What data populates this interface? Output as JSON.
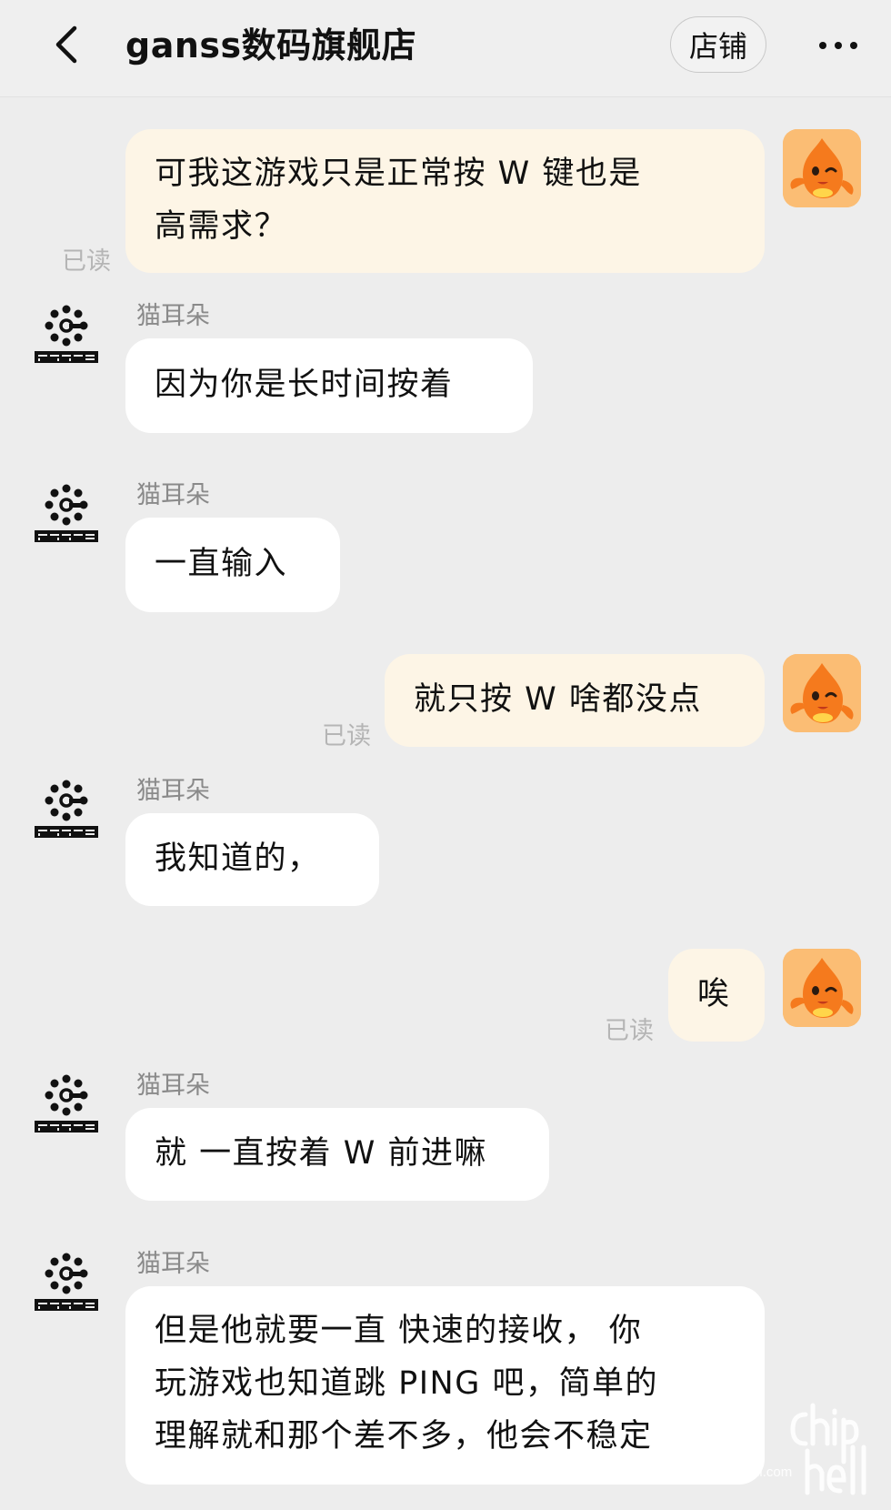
{
  "header": {
    "title": "ganss数码旗舰店",
    "shop_button": "店铺"
  },
  "messages": [
    {
      "side": "me",
      "lines": [
        "可我这游戏只是正常按 W 键也是",
        "高需求？"
      ],
      "status": "已读"
    },
    {
      "side": "them",
      "sender": "猫耳朵",
      "lines": [
        "因为你是长时间按着"
      ]
    },
    {
      "side": "them",
      "sender": "猫耳朵",
      "lines": [
        "一直输入"
      ]
    },
    {
      "side": "me",
      "lines": [
        "就只按 W 啥都没点"
      ],
      "status": "已读"
    },
    {
      "side": "them",
      "sender": "猫耳朵",
      "lines": [
        "我知道的，"
      ]
    },
    {
      "side": "me",
      "lines": [
        "唉"
      ],
      "status": "已读"
    },
    {
      "side": "them",
      "sender": "猫耳朵",
      "lines": [
        "就 一直按着 W 前进嘛"
      ]
    },
    {
      "side": "them",
      "sender": "猫耳朵",
      "lines": [
        "但是他就要一直 快速的接收， 你",
        "玩游戏也知道跳 PING 吧，简单的",
        "理解就和那个差不多，他会不稳定"
      ]
    }
  ],
  "watermark": {
    "logo_text": "chip hell",
    "url": "www.chiphell.com"
  },
  "colors": {
    "page_bg": "#ededed",
    "my_bubble": "#fdf5e6",
    "their_bubble": "#ffffff",
    "avatar_orange": "#f07c1f"
  }
}
